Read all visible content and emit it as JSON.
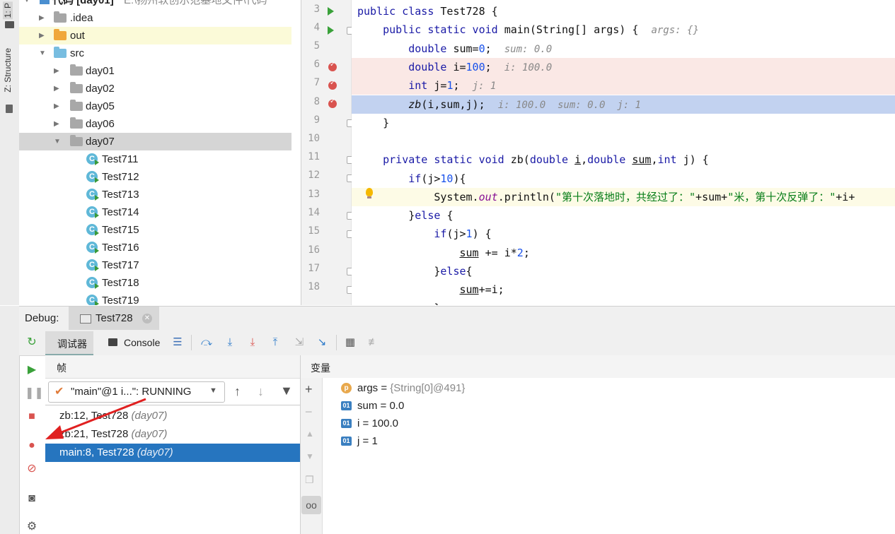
{
  "left_strip": {
    "tab1": "1: P",
    "tab2": "Z: Structure"
  },
  "project_tree": {
    "root_label": "代码 [day01]",
    "root_path": "E:\\扬州软创示范基地文件\\代码",
    "items": [
      {
        "label": ".idea",
        "kind": "folder-grey",
        "level": 1,
        "expanded": false
      },
      {
        "label": "out",
        "kind": "folder-orange",
        "level": 1,
        "expanded": false
      },
      {
        "label": "src",
        "kind": "folder-blue",
        "level": 1,
        "expanded": true
      },
      {
        "label": "day01",
        "kind": "package",
        "level": 2,
        "expanded": false
      },
      {
        "label": "day02",
        "kind": "package",
        "level": 2,
        "expanded": false
      },
      {
        "label": "day05",
        "kind": "package",
        "level": 2,
        "expanded": false
      },
      {
        "label": "day06",
        "kind": "package",
        "level": 2,
        "expanded": false
      },
      {
        "label": "day07",
        "kind": "package",
        "level": 2,
        "expanded": true
      },
      {
        "label": "Test711",
        "kind": "class",
        "level": 3
      },
      {
        "label": "Test712",
        "kind": "class",
        "level": 3
      },
      {
        "label": "Test713",
        "kind": "class",
        "level": 3
      },
      {
        "label": "Test714",
        "kind": "class",
        "level": 3
      },
      {
        "label": "Test715",
        "kind": "class",
        "level": 3
      },
      {
        "label": "Test716",
        "kind": "class",
        "level": 3
      },
      {
        "label": "Test717",
        "kind": "class",
        "level": 3
      },
      {
        "label": "Test718",
        "kind": "class",
        "level": 3
      },
      {
        "label": "Test719",
        "kind": "class",
        "level": 3
      }
    ]
  },
  "editor": {
    "line_numbers": [
      "3",
      "4",
      "5",
      "6",
      "7",
      "8",
      "9",
      "10",
      "11",
      "12",
      "13",
      "14",
      "15",
      "16",
      "17",
      "18"
    ],
    "lines": [
      {
        "n": "3",
        "code": "public class Test728 {"
      },
      {
        "n": "4",
        "code": "    public static void main(String[] args) {",
        "hint": "args: {}"
      },
      {
        "n": "5",
        "code": "        double sum=0;",
        "hint": "sum: 0.0"
      },
      {
        "n": "6",
        "code": "        double i=100;",
        "hint": "i: 100.0"
      },
      {
        "n": "7",
        "code": "        int j=1;",
        "hint": "j: 1"
      },
      {
        "n": "8",
        "code": "        zb(i,sum,j);",
        "hint": "i: 100.0  sum: 0.0  j: 1"
      },
      {
        "n": "9",
        "code": "    }"
      },
      {
        "n": "10",
        "code": ""
      },
      {
        "n": "11",
        "code": "    private static void zb(double i,double sum,int j) {"
      },
      {
        "n": "12",
        "code": "        if(j>10){"
      },
      {
        "n": "13",
        "code": "            System.out.println(\"第十次落地时，共经过了：\"+sum+\"米，第十次反弹了：\"+i+"
      },
      {
        "n": "14",
        "code": "        }else {"
      },
      {
        "n": "15",
        "code": "            if(j>1) {"
      },
      {
        "n": "16",
        "code": "                sum += i*2;"
      },
      {
        "n": "17",
        "code": "            }else{"
      },
      {
        "n": "18",
        "code": "                sum+=i;"
      }
    ]
  },
  "debug": {
    "title": "Debug:",
    "session_tab": "Test728",
    "tabs": {
      "debugger": "调试器",
      "console": "Console"
    },
    "frames_header": "帧",
    "variables_header": "变量",
    "thread_select": "\"main\"@1 i...\": RUNNING",
    "frames": [
      {
        "method": "zb:12, Test728",
        "pkg": "(day07)",
        "selected": false
      },
      {
        "method": "zb:21, Test728",
        "pkg": "(day07)",
        "selected": false
      },
      {
        "method": "main:8, Test728",
        "pkg": "(day07)",
        "selected": true
      }
    ],
    "variables": [
      {
        "badge": "p",
        "name": "args",
        "value": "{String[0]@491}"
      },
      {
        "badge": "01",
        "name": "sum",
        "value": "0.0"
      },
      {
        "badge": "01",
        "name": "i",
        "value": "100.0"
      },
      {
        "badge": "01",
        "name": "j",
        "value": "1"
      }
    ]
  },
  "colors": {
    "breakpoint_line": "#fae8e5",
    "execution_line": "#c2d2f0",
    "selected_frame": "#2675bf",
    "annotation_arrow": "#e02020"
  }
}
